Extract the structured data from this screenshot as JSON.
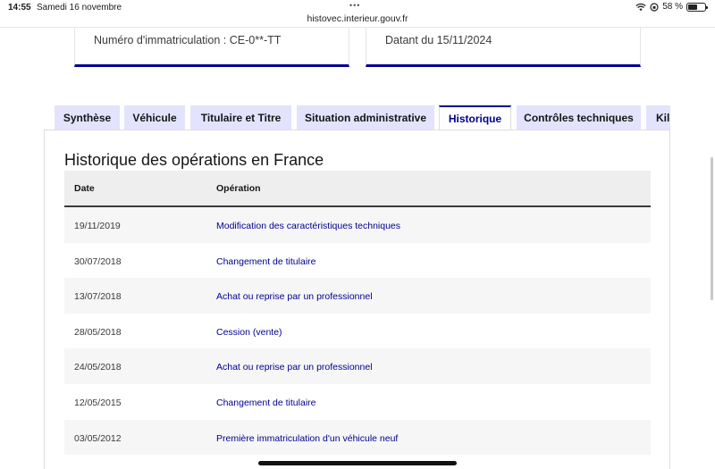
{
  "status_bar": {
    "time": "14:55",
    "date": "Samedi 16 novembre",
    "dots": "•••",
    "battery_text": "58 %",
    "battery_level": 0.58
  },
  "browser": {
    "url": "histovec.interieur.gouv.fr"
  },
  "cards": {
    "registration": "Numéro d'immatriculation : CE-0**-TT",
    "date": "Datant du 15/11/2024"
  },
  "tabs": [
    {
      "label": "Synthèse"
    },
    {
      "label": "Véhicule"
    },
    {
      "label": "Titulaire et Titre"
    },
    {
      "label": "Situation administrative"
    },
    {
      "label": "Historique"
    },
    {
      "label": "Contrôles techniques"
    },
    {
      "label": "Kilométrage"
    }
  ],
  "history": {
    "title": "Historique des opérations en France",
    "headers": {
      "date": "Date",
      "operation": "Opération"
    },
    "rows": [
      {
        "date": "19/11/2019",
        "operation": "Modification des caractéristiques techniques"
      },
      {
        "date": "30/07/2018",
        "operation": "Changement de titulaire"
      },
      {
        "date": "13/07/2018",
        "operation": "Achat ou reprise par un professionnel"
      },
      {
        "date": "28/05/2018",
        "operation": "Cession (vente)"
      },
      {
        "date": "24/05/2018",
        "operation": "Achat ou reprise par un professionnel"
      },
      {
        "date": "12/05/2015",
        "operation": "Changement de titulaire"
      },
      {
        "date": "03/05/2012",
        "operation": "Première immatriculation d'un véhicule neuf"
      }
    ]
  },
  "colors": {
    "accent": "#000091",
    "tab_bg": "#e3e3fd",
    "header_bg": "#eeeeee",
    "stripe_bg": "#f6f6f6"
  }
}
